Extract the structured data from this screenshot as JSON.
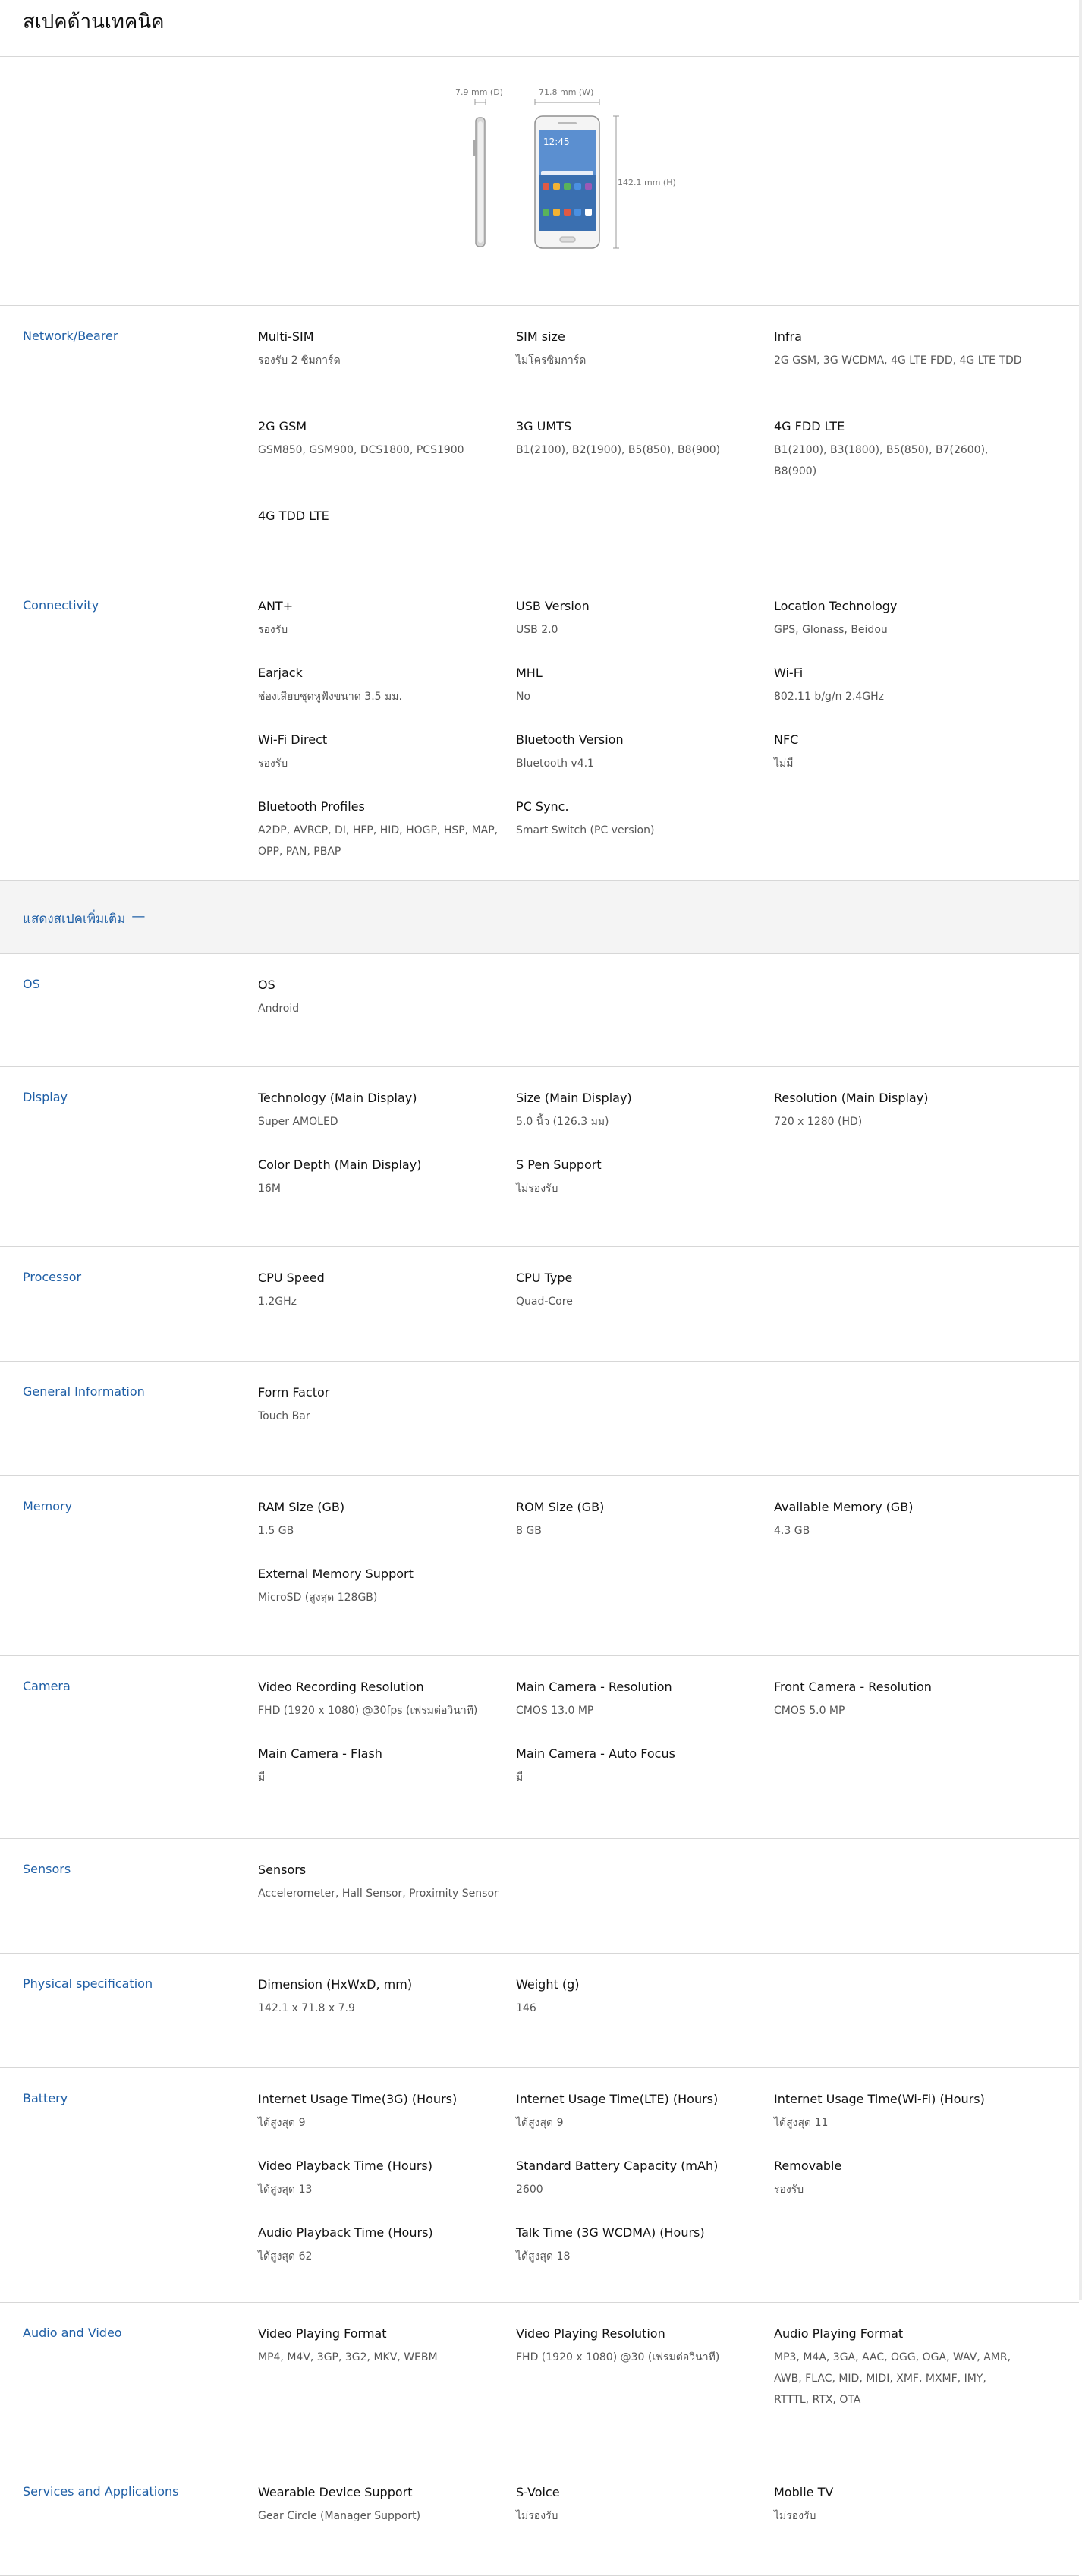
{
  "page_title": "สเปคด้านเทคนิค",
  "hero": {
    "depth_label": "7.9 mm (D)",
    "width_label": "71.8 mm (W)",
    "height_label": "142.1 mm (H)",
    "screen_time": "12:45"
  },
  "show_more_label": "แสดงสเปคเพิ่มเติม",
  "sections_top": [
    {
      "key": "network",
      "label": "Network/Bearer",
      "items": [
        {
          "name": "Multi-SIM",
          "value": "รองรับ 2 ซิมการ์ด"
        },
        {
          "name": "SIM size",
          "value": "ไมโครซิมการ์ด"
        },
        {
          "name": "Infra",
          "value": "2G GSM, 3G WCDMA, 4G LTE FDD, 4G LTE TDD"
        },
        {
          "name": "2G GSM",
          "value": "GSM850, GSM900, DCS1800, PCS1900"
        },
        {
          "name": "3G UMTS",
          "value": "B1(2100), B2(1900), B5(850), B8(900)"
        },
        {
          "name": "4G FDD LTE",
          "value": "B1(2100), B3(1800), B5(850), B7(2600), B8(900)"
        },
        {
          "name": "4G TDD LTE",
          "value": ""
        }
      ]
    },
    {
      "key": "connectivity",
      "label": "Connectivity",
      "items": [
        {
          "name": "ANT+",
          "value": "รองรับ"
        },
        {
          "name": "USB Version",
          "value": "USB 2.0"
        },
        {
          "name": "Location Technology",
          "value": "GPS, Glonass, Beidou"
        },
        {
          "name": "Earjack",
          "value": "ช่องเสียบชุดหูฟังขนาด 3.5 มม."
        },
        {
          "name": "MHL",
          "value": "No"
        },
        {
          "name": "Wi-Fi",
          "value": "802.11 b/g/n 2.4GHz"
        },
        {
          "name": "Wi-Fi Direct",
          "value": "รองรับ"
        },
        {
          "name": "Bluetooth Version",
          "value": "Bluetooth v4.1"
        },
        {
          "name": "NFC",
          "value": "ไม่มี"
        },
        {
          "name": "Bluetooth Profiles",
          "value": "A2DP, AVRCP, DI, HFP, HID, HOGP, HSP, MAP, OPP, PAN, PBAP"
        },
        {
          "name": "PC Sync.",
          "value": "Smart Switch (PC version)"
        }
      ]
    }
  ],
  "sections_more": [
    {
      "key": "os",
      "label": "OS",
      "items": [
        {
          "name": "OS",
          "value": "Android"
        }
      ]
    },
    {
      "key": "display",
      "label": "Display",
      "items": [
        {
          "name": "Technology (Main Display)",
          "value": "Super AMOLED"
        },
        {
          "name": "Size (Main Display)",
          "value": "5.0 นิ้ว (126.3 มม)"
        },
        {
          "name": "Resolution (Main Display)",
          "value": "720 x 1280 (HD)"
        },
        {
          "name": "Color Depth (Main Display)",
          "value": "16M"
        },
        {
          "name": "S Pen Support",
          "value": "ไม่รองรับ"
        }
      ]
    },
    {
      "key": "processor",
      "label": "Processor",
      "items": [
        {
          "name": "CPU Speed",
          "value": "1.2GHz"
        },
        {
          "name": "CPU Type",
          "value": "Quad-Core"
        }
      ]
    },
    {
      "key": "general",
      "label": "General Information",
      "items": [
        {
          "name": "Form Factor",
          "value": "Touch Bar"
        }
      ]
    },
    {
      "key": "memory",
      "label": "Memory",
      "items": [
        {
          "name": "RAM Size (GB)",
          "value": "1.5 GB"
        },
        {
          "name": "ROM Size (GB)",
          "value": "8 GB"
        },
        {
          "name": "Available Memory (GB)",
          "value": "4.3 GB"
        },
        {
          "name": "External Memory Support",
          "value": "MicroSD (สูงสุด 128GB)"
        }
      ]
    },
    {
      "key": "camera",
      "label": "Camera",
      "items": [
        {
          "name": "Video Recording Resolution",
          "value": "FHD (1920 x 1080) @30fps (เฟรมต่อวินาที)"
        },
        {
          "name": "Main Camera - Resolution",
          "value": "CMOS 13.0 MP"
        },
        {
          "name": "Front Camera - Resolution",
          "value": "CMOS 5.0 MP"
        },
        {
          "name": "Main Camera - Flash",
          "value": "มี"
        },
        {
          "name": "Main Camera - Auto Focus",
          "value": "มี"
        }
      ]
    },
    {
      "key": "sensors",
      "label": "Sensors",
      "items": [
        {
          "name": "Sensors",
          "value": "Accelerometer, Hall Sensor, Proximity Sensor"
        }
      ]
    },
    {
      "key": "physical",
      "label": "Physical specification",
      "items": [
        {
          "name": "Dimension (HxWxD, mm)",
          "value": "142.1 x 71.8 x 7.9"
        },
        {
          "name": "Weight (g)",
          "value": "146"
        }
      ]
    },
    {
      "key": "battery",
      "label": "Battery",
      "items": [
        {
          "name": "Internet Usage Time(3G) (Hours)",
          "value": "ได้สูงสุด 9"
        },
        {
          "name": "Internet Usage Time(LTE) (Hours)",
          "value": "ได้สูงสุด 9"
        },
        {
          "name": "Internet Usage Time(Wi-Fi) (Hours)",
          "value": "ได้สูงสุด 11"
        },
        {
          "name": "Video Playback Time (Hours)",
          "value": "ได้สูงสุด 13"
        },
        {
          "name": "Standard Battery Capacity (mAh)",
          "value": "2600"
        },
        {
          "name": "Removable",
          "value": "รองรับ"
        },
        {
          "name": "Audio Playback Time (Hours)",
          "value": "ได้สูงสุด 62"
        },
        {
          "name": "Talk Time (3G WCDMA) (Hours)",
          "value": "ได้สูงสุด 18"
        }
      ]
    },
    {
      "key": "audio-video",
      "label": "Audio and Video",
      "items": [
        {
          "name": "Video Playing Format",
          "value": "MP4, M4V, 3GP, 3G2, MKV, WEBM"
        },
        {
          "name": "Video Playing Resolution",
          "value": "FHD (1920 x 1080) @30 (เฟรมต่อวินาที)"
        },
        {
          "name": "Audio Playing Format",
          "value": "MP3, M4A, 3GA, AAC, OGG, OGA, WAV, AMR, AWB, FLAC, MID, MIDI, XMF, MXMF, IMY, RTTTL, RTX, OTA"
        }
      ]
    },
    {
      "key": "services",
      "label": "Services and Applications",
      "items": [
        {
          "name": "Wearable Device Support",
          "value": "Gear Circle (Manager Support)"
        },
        {
          "name": "S-Voice",
          "value": "ไม่รองรับ"
        },
        {
          "name": "Mobile TV",
          "value": "ไม่รองรับ"
        }
      ]
    }
  ]
}
